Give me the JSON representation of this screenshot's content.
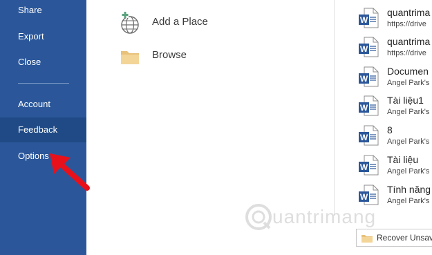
{
  "nav": {
    "items": [
      {
        "label": "Share"
      },
      {
        "label": "Export"
      },
      {
        "label": "Close"
      },
      {
        "label": "Account"
      },
      {
        "label": "Feedback",
        "selected": true
      },
      {
        "label": "Options"
      }
    ]
  },
  "places": {
    "add_place": "Add a Place",
    "browse": "Browse"
  },
  "recent": [
    {
      "name": "quantrima",
      "path": "https://drive"
    },
    {
      "name": "quantrima",
      "path": "https://drive"
    },
    {
      "name": "Documen",
      "path": "Angel Park's"
    },
    {
      "name": "Tài liệu1",
      "path": "Angel Park's"
    },
    {
      "name": "8",
      "path": "Angel Park's"
    },
    {
      "name": "Tài liệu",
      "path": "Angel Park's"
    },
    {
      "name": "Tính năng",
      "path": "Angel Park's"
    }
  ],
  "recover_button": "Recover Unsave",
  "watermark": {
    "text": "uantrimang"
  },
  "colors": {
    "nav_bg": "#2b579a",
    "nav_selected": "#1f4a85",
    "word_blue": "#2b579a",
    "annotation_red": "#e8111b"
  },
  "icons": {
    "add_place": "globe-plus-icon",
    "browse": "folder-icon",
    "doc": "word-document-icon",
    "recover": "folder-icon"
  }
}
